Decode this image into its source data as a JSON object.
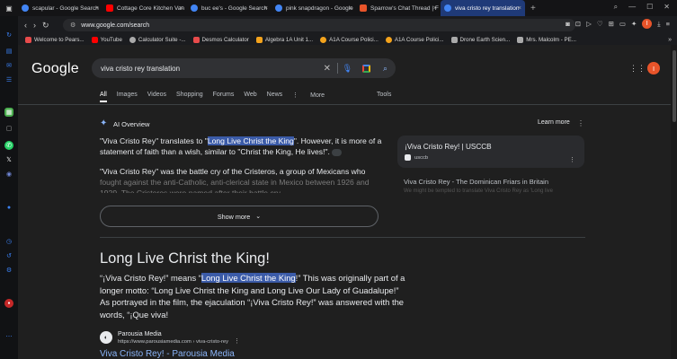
{
  "tabs": [
    {
      "label": "scapular - Google Search",
      "color": "#4285f4"
    },
    {
      "label": "Cottage Core Kitchen Van",
      "color": "#ff0000"
    },
    {
      "label": "buc ee's - Google Search",
      "color": "#4285f4"
    },
    {
      "label": "pink snapdragon - Google",
      "color": "#4285f4"
    },
    {
      "label": "Sparrow's Chat Thread | F",
      "color": "#e8542a"
    },
    {
      "label": "viva cristo rey translation",
      "color": "#4285f4",
      "active": true
    }
  ],
  "url": "www.google.com/search",
  "profile_letter": "I",
  "bookmarks": [
    {
      "label": "Welcome to Pears...",
      "color": "#e84b4b"
    },
    {
      "label": "YouTube",
      "color": "#ff0000"
    },
    {
      "label": "Calculator Suite -...",
      "color": "#aaaaaa"
    },
    {
      "label": "Desmos Calculator",
      "color": "#e84b4b"
    },
    {
      "label": "Algebra 1A Unit 1...",
      "color": "#f4a31c"
    },
    {
      "label": "A1A Course Polici...",
      "color": "#f4a31c"
    },
    {
      "label": "A1A Course Polici...",
      "color": "#f4a31c"
    },
    {
      "label": "Drone Earth Scien...",
      "color": "#aaaaaa"
    },
    {
      "label": "Mrs. Malcolm - PE...",
      "color": "#aaaaaa"
    }
  ],
  "google": {
    "logo": "Google",
    "query": "viva cristo rey translation",
    "nav": [
      "All",
      "Images",
      "Videos",
      "Shopping",
      "Forums",
      "Web",
      "News",
      "More"
    ],
    "tools": "Tools"
  },
  "ai": {
    "title": "AI Overview",
    "learn_more": "Learn more",
    "p1_a": "\"Viva Cristo Rey\" translates to \"",
    "p1_hl": "Long Live Christ the King",
    "p1_b": "\". However, it is more of a statement of faith than a wish, similar to \"Christ the King, He lives!\".",
    "p2_a": "\"Viva Cristo Rey\" was the battle cry of the Cristeros, a group of Mexicans who",
    "p2_fade": "fought against the anti-Catholic, anti-clerical state in Mexico between 1926 and 1929. The Cristeros were named after their battle cry,",
    "show_more": "Show more",
    "card_title": "¡Viva Cristo Rey! | USCCB",
    "card_source": "usccb",
    "card2_title": "Viva Cristo Rey - The Dominican Friars in Britain",
    "card2_fade": "We might be tempted to translate Viva Cristo Rey as 'Long live"
  },
  "result": {
    "heading": "Long Live Christ the King!",
    "p_a": "“¡Viva Cristo Rey!” means “",
    "p_hl": "Long Live Christ the King",
    "p_b": "!” This was originally part of a longer motto: “Long Live Christ the King and Long Live Our Lady of Guadalupe!” As portrayed in the film, the ejaculation “¡Viva Cristo Rey!” was answered with the words, “¡Que viva!",
    "site": "Parousia Media",
    "site_url": "https://www.parousiamedia.com › viva-cristo-rey",
    "link": "Viva Cristo Rey! - Parousia Media"
  }
}
